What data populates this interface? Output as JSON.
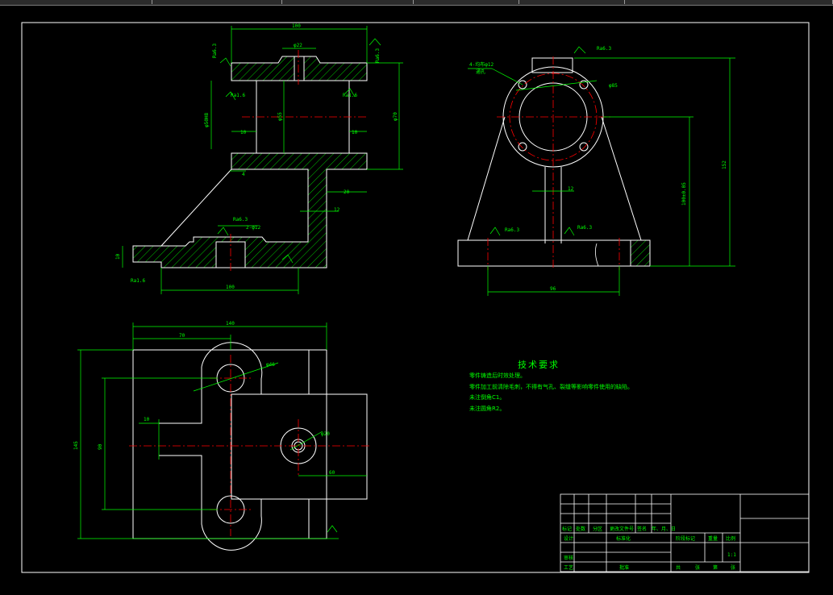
{
  "window": {
    "toolbar_segments": [
      "",
      "",
      "",
      "",
      "",
      ""
    ]
  },
  "colors": {
    "background": "#000000",
    "outline": "#ffffff",
    "dimension": "#00ff00",
    "centerline": "#ff0000",
    "hatch": "#00ff00"
  },
  "views": {
    "front": {
      "dims": {
        "top_width": "100",
        "top_hole": "φ22",
        "left_height": "φ50H8",
        "bore_dia": "φ55",
        "right_height": "φ70",
        "wall_left": "10",
        "wall_right": "10",
        "step": "4",
        "rib": "20",
        "rib_height": "12",
        "base_thick": "10",
        "base_width": "100",
        "base_hole": "2-φ12"
      },
      "roughness": [
        "Ra6.3",
        "Ra6.3",
        "Ra1.6",
        "Ra1.6",
        "Ra6.3",
        "Ra1.6"
      ]
    },
    "side": {
      "dims": {
        "bolt_holes": "4-均布φ12",
        "bolt_note": "通孔",
        "pcd": "φ85",
        "total_height": "152",
        "center_height": "100±0.05",
        "rib_thick": "12",
        "base_width": "96"
      },
      "roughness": [
        "Ra6.3",
        "Ra6.3",
        "Ra6.3"
      ]
    },
    "top": {
      "dims": {
        "total_width": "140",
        "hole_offset": "70",
        "boss_dia": "φ46",
        "hole_dia": "φ20",
        "slot": "10",
        "depth": "60",
        "span": "90",
        "total_length": "145"
      }
    }
  },
  "technical_requirements": {
    "title": "技术要求",
    "lines": [
      "零件铸造后时效处理。",
      "零件加工前清除毛刺，不得有气孔、裂缝等影响零件使用的缺陷。",
      "未注倒角C1。",
      "未注圆角R2。"
    ]
  },
  "title_block": {
    "row_labels": [
      "标记",
      "处数",
      "分区",
      "更改文件号",
      "签名",
      "年、月、日"
    ],
    "design": "设计",
    "standard": "标准化",
    "review": "审核",
    "process": "工艺",
    "approve": "批准",
    "stage_label": "阶段标记",
    "weight_label": "重量",
    "scale_label": "比例",
    "scale_value": "1:1",
    "sheet_all": "共",
    "sheet_count": "张",
    "sheet_no": "第",
    "sheet_unit": "张"
  }
}
